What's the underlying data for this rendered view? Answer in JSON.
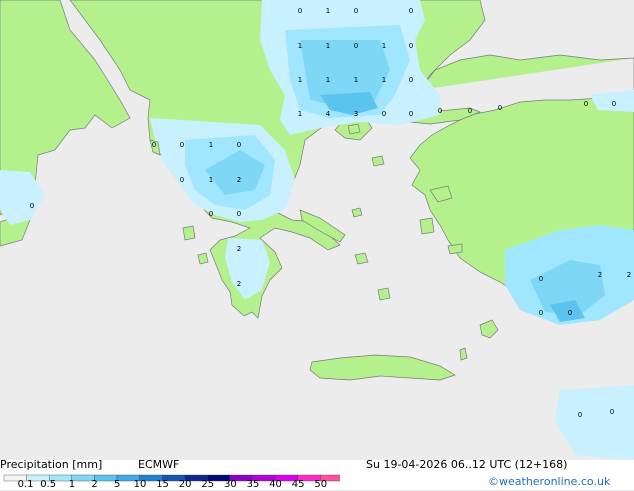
{
  "footer": {
    "title": "Precipitation [mm]",
    "model": "ECMWF",
    "datetime": "Su 19-04-2026 06..12 UTC (12+168)",
    "credit": "©weatheronline.co.uk"
  },
  "legend": {
    "ticks": [
      "0.1",
      "0.5",
      "1",
      "2",
      "5",
      "10",
      "15",
      "20",
      "25",
      "30",
      "35",
      "40",
      "45",
      "50"
    ],
    "colors": [
      "#f5f5f5",
      "#c8f0ff",
      "#a0e6ff",
      "#7dd7f5",
      "#5ac3ee",
      "#3caae6",
      "#1e82d2",
      "#1455b4",
      "#0a2896",
      "#000a78",
      "#8c00c8",
      "#b400dc",
      "#dc00f0",
      "#ff28c8",
      "#ff50a0"
    ]
  },
  "map_colors": {
    "sea": "#ececec",
    "land": "#b4f08c",
    "coast": "#7a7a7a"
  },
  "precip_labels": [
    "0",
    "1",
    "0",
    "0",
    "1",
    "1",
    "0",
    "1",
    "0",
    "1",
    "1",
    "1",
    "1",
    "0",
    "1",
    "4",
    "3",
    "0",
    "0",
    "0",
    "0",
    "0",
    "0",
    "0",
    "0",
    "0",
    "1",
    "0",
    "0",
    "1",
    "2",
    "0",
    "0",
    "0",
    "2",
    "2",
    "0",
    "2",
    "2",
    "0",
    "0"
  ]
}
